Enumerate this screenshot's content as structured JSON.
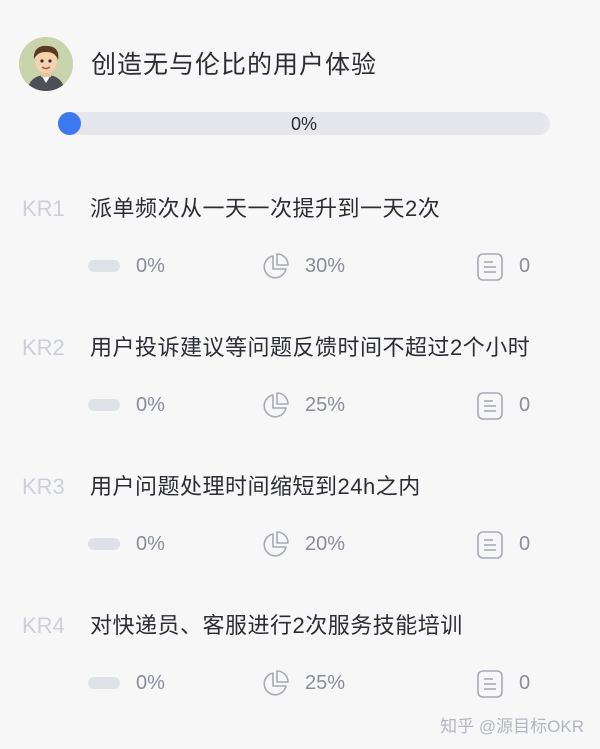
{
  "objective": {
    "title": "创造无与伦比的用户体验",
    "progress_label": "0%",
    "progress_value": 0
  },
  "colors": {
    "accent": "#3b79f0",
    "track": "#e6e7ec",
    "kr_code": "#cdd0d9",
    "muted_text": "#8a8d99"
  },
  "key_results": [
    {
      "code": "KR1",
      "title": "派单频次从一天一次提升到一天2次",
      "progress": "0%",
      "confidence": "30%",
      "tasks": "0"
    },
    {
      "code": "KR2",
      "title": "用户投诉建议等问题反馈时间不超过2个小时",
      "progress": "0%",
      "confidence": "25%",
      "tasks": "0"
    },
    {
      "code": "KR3",
      "title": "用户问题处理时间缩短到24h之内",
      "progress": "0%",
      "confidence": "20%",
      "tasks": "0"
    },
    {
      "code": "KR4",
      "title": "对快递员、客服进行2次服务技能培训",
      "progress": "0%",
      "confidence": "25%",
      "tasks": "0"
    }
  ],
  "icons": {
    "avatar": "avatar-cartoon-man",
    "progress": "progress-pill-icon",
    "confidence": "pie-chart-icon",
    "tasks": "document-list-icon"
  },
  "watermark": "知乎 @源目标OKR"
}
